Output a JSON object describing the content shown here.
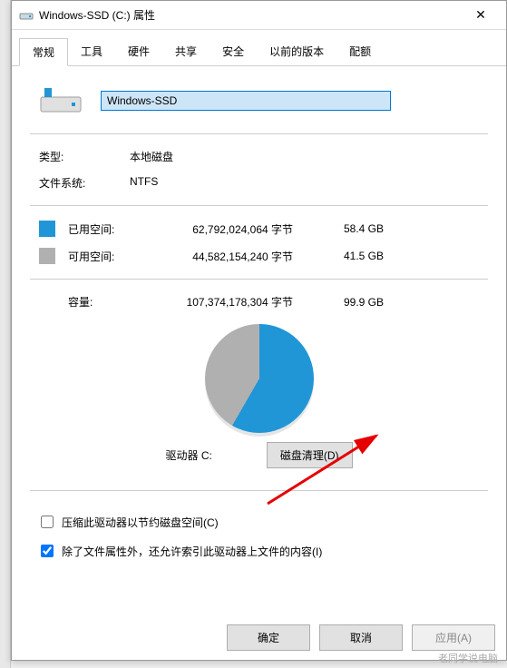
{
  "window": {
    "title": "Windows-SSD (C:) 属性"
  },
  "tabs": [
    "常规",
    "工具",
    "硬件",
    "共享",
    "安全",
    "以前的版本",
    "配额"
  ],
  "drive": {
    "name": "Windows-SSD"
  },
  "labels": {
    "type": "类型:",
    "filesystem": "文件系统:",
    "used": "已用空间:",
    "free": "可用空间:",
    "capacity": "容量:",
    "drive_caption": "驱动器 C:",
    "cleanup_btn": "磁盘清理(D)"
  },
  "values": {
    "type": "本地磁盘",
    "filesystem": "NTFS",
    "used_bytes": "62,792,024,064 字节",
    "used_human": "58.4 GB",
    "free_bytes": "44,582,154,240 字节",
    "free_human": "41.5 GB",
    "capacity_bytes": "107,374,178,304 字节",
    "capacity_human": "99.9 GB"
  },
  "checkboxes": {
    "compress": {
      "label": "压缩此驱动器以节约磁盘空间(C)",
      "checked": false
    },
    "index": {
      "label": "除了文件属性外，还允许索引此驱动器上文件的内容(I)",
      "checked": true
    }
  },
  "footer": {
    "ok": "确定",
    "cancel": "取消",
    "apply": "应用(A)"
  },
  "watermark": "老同学说电脑",
  "chart_data": {
    "type": "pie",
    "title": "驱动器 C:",
    "series": [
      {
        "name": "已用空间",
        "value": 58.4,
        "color": "#2196d6"
      },
      {
        "name": "可用空间",
        "value": 41.5,
        "color": "#b0b0b0"
      }
    ],
    "unit": "GB",
    "total": 99.9
  }
}
